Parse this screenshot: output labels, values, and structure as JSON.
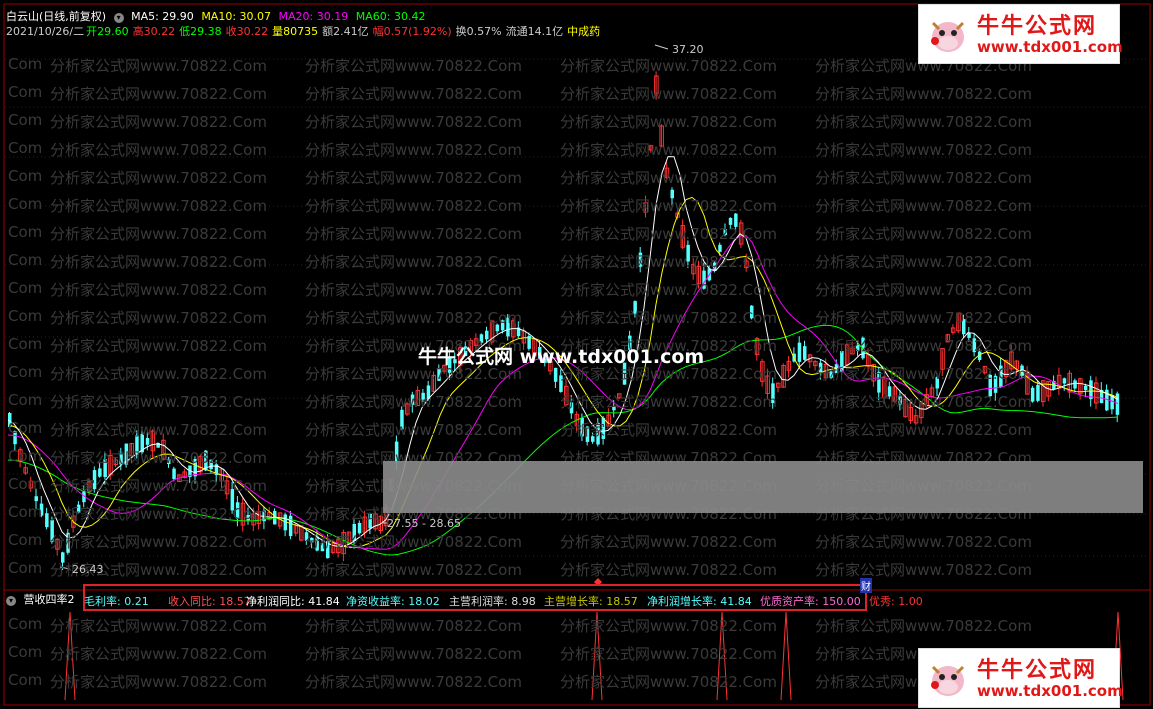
{
  "header": {
    "stock_name": "白云山(日线,前复权)",
    "ma5": "MA5: 29.90",
    "ma10": "MA10: 30.07",
    "ma20": "MA20: 30.19",
    "ma60": "MA60: 30.42",
    "date": "2021/10/26/二",
    "open": "开29.60",
    "high": "高30.22",
    "low": "低29.38",
    "close": "收30.22",
    "volume": "量80735",
    "amount": "额2.41亿",
    "change": "幅0.57(1.92%)",
    "turnover": "换0.57%",
    "float_cap": "流通14.1亿",
    "sector": "中成药"
  },
  "colors": {
    "ma5": "#ffffff",
    "ma10": "#ffff00",
    "ma20": "#ff00ff",
    "ma60": "#00ff00",
    "up": "#ff3232",
    "down": "#54ffff"
  },
  "price_labels": {
    "high": "37.20",
    "low": "26.43",
    "range": "27.55 - 28.65"
  },
  "watermark": {
    "text": "分析家公式网www.70822.Com",
    "short": "Com",
    "center": "牛牛公式网 www.tdx001.com",
    "logo_cn": "牛牛公式网",
    "logo_url": "www.tdx001.com"
  },
  "indicator": {
    "name": "营收四率2",
    "items": [
      {
        "label": "毛利率: 0.21",
        "color": "#54ffff"
      },
      {
        "label": "收入同比: 18.57",
        "color": "#ff5050"
      },
      {
        "label": "净利润同比: 41.84",
        "color": "#ffffff"
      },
      {
        "label": "净资收益率: 18.02",
        "color": "#54ffff"
      },
      {
        "label": "主营利润率: 8.98",
        "color": "#dddddd"
      },
      {
        "label": "主营增长率: 18.57",
        "color": "#c8c800"
      },
      {
        "label": "净利润增长率: 41.84",
        "color": "#54ffff"
      },
      {
        "label": "优质资产率: 150.00",
        "color": "#ff6ad5"
      },
      {
        "label": "优秀: 1.00",
        "color": "#ff3232"
      }
    ],
    "marker": "财"
  }
}
